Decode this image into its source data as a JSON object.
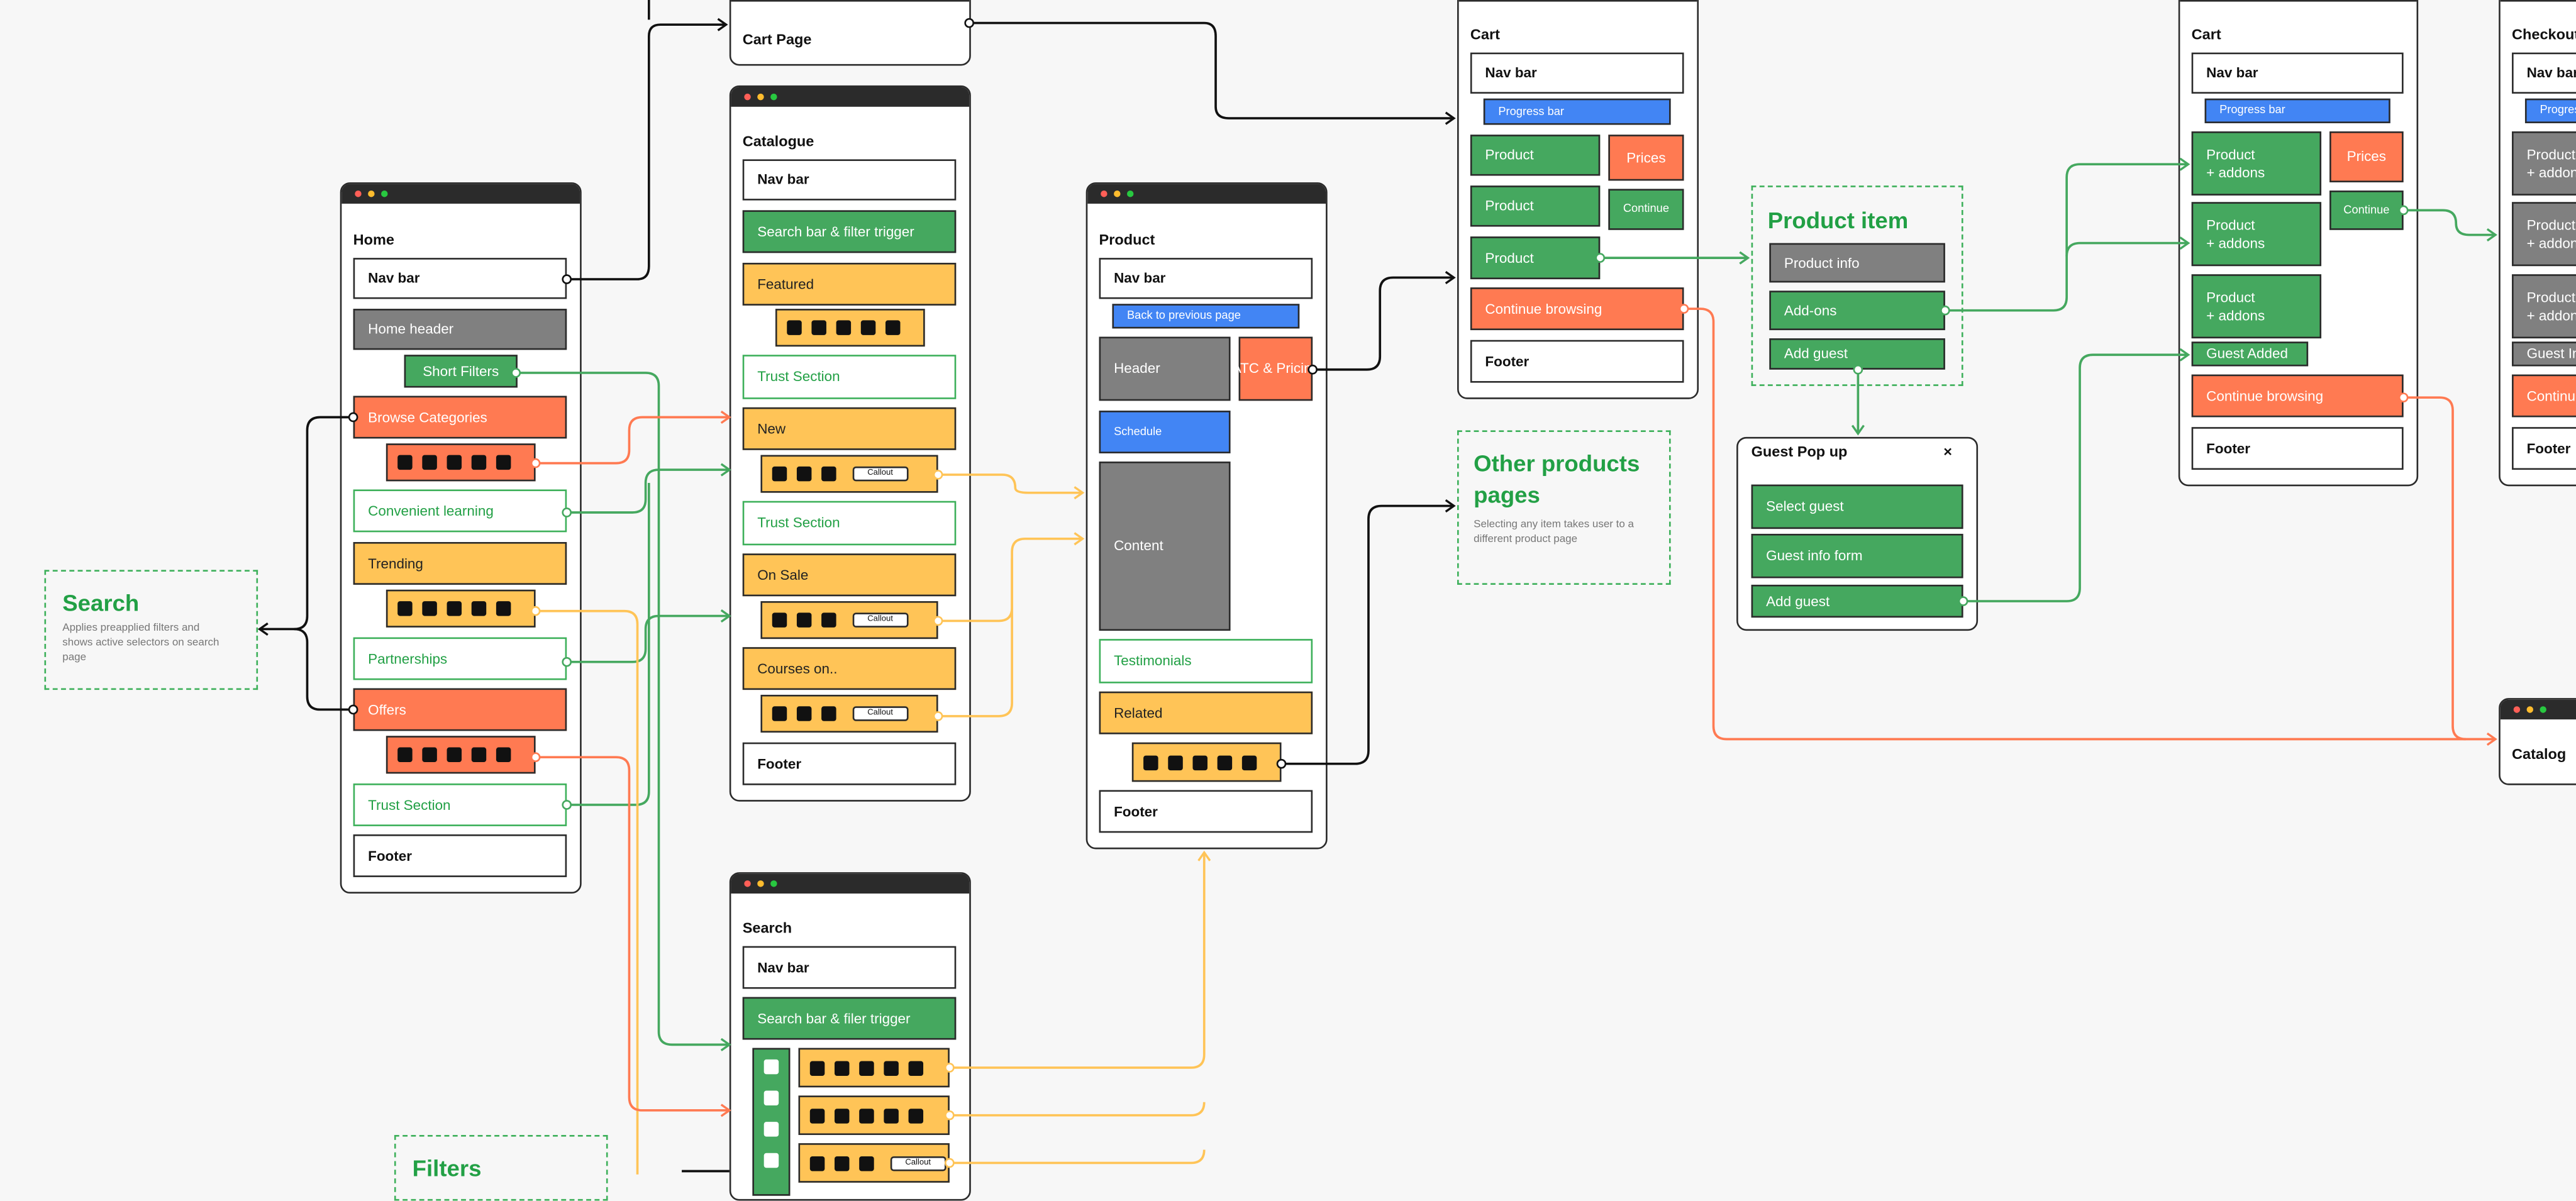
{
  "colors": {
    "green": "#45a85f",
    "orange": "#ff7a52",
    "yellow": "#ffc457",
    "gray": "#808080",
    "blue": "#4285f4",
    "text_green": "#22a045",
    "wire_black": "#111111"
  },
  "home": {
    "title": "Home",
    "nav": "Nav bar",
    "header": "Home header",
    "short_filters": "Short Filters",
    "browse": "Browse Categories",
    "convenient": "Convenient learning",
    "trending": "Trending",
    "partnerships": "Partnerships",
    "offers": "Offers",
    "trust": "Trust Section",
    "footer": "Footer"
  },
  "cart_page": {
    "title": "Cart Page"
  },
  "catalogue": {
    "title": "Catalogue",
    "nav": "Nav bar",
    "search": "Search bar & filter trigger",
    "featured": "Featured",
    "trust1": "Trust Section",
    "new": "New",
    "trust2": "Trust Section",
    "on_sale": "On Sale",
    "courses": "Courses on..",
    "footer": "Footer",
    "callout": "Callout"
  },
  "search_page": {
    "title": "Search",
    "nav": "Nav bar",
    "search": "Search bar & filer trigger",
    "callout": "Callout"
  },
  "product": {
    "title": "Product",
    "nav": "Nav bar",
    "back": "Back to previous page",
    "header": "Header",
    "atc": "ATC & Pricing",
    "schedule": "Schedule",
    "content": "Content",
    "testimonials": "Testimonials",
    "related": "Related",
    "footer": "Footer"
  },
  "cart": {
    "title": "Cart",
    "nav": "Nav bar",
    "progress": "Progress bar",
    "product1": "Product",
    "product2": "Product",
    "product3": "Product",
    "prices": "Prices",
    "continue": "Continue",
    "continue_browsing": "Continue browsing",
    "footer": "Footer"
  },
  "other_products": {
    "title": "Other products pages",
    "desc": "Selecting any item takes user to a different product page"
  },
  "product_item": {
    "title": "Product item",
    "info": "Product info",
    "addons": "Add-ons",
    "add_guest": "Add guest"
  },
  "guest_popup": {
    "title": "Guest Pop up",
    "close": "×",
    "select": "Select guest",
    "form": "Guest info form",
    "add": "Add guest"
  },
  "cart2": {
    "title": "Cart",
    "nav": "Nav bar",
    "progress": "Progress bar",
    "product1": "Product\n+ addons",
    "product2": "Product\n+ addons",
    "product3": "Product\n+ addons",
    "prices": "Prices",
    "continue": "Continue",
    "guest_added": "Guest Added",
    "continue_browsing": "Continue browsing",
    "footer": "Footer"
  },
  "checkout": {
    "title": "Checkout",
    "nav": "Nav bar",
    "progress": "Progress bar",
    "product1": "Product\n+ addons",
    "product2": "Product\n+ addons",
    "product3": "Product\n+ addons",
    "guest": "Guest Info",
    "continue_browsing": "Continue browsing",
    "footer": "Footer"
  },
  "catalog": {
    "title": "Catalog"
  },
  "search_note": {
    "title": "Search",
    "desc": "Applies preapplied filters and shows active selectors on search page"
  },
  "filters_note": {
    "title": "Filters"
  }
}
